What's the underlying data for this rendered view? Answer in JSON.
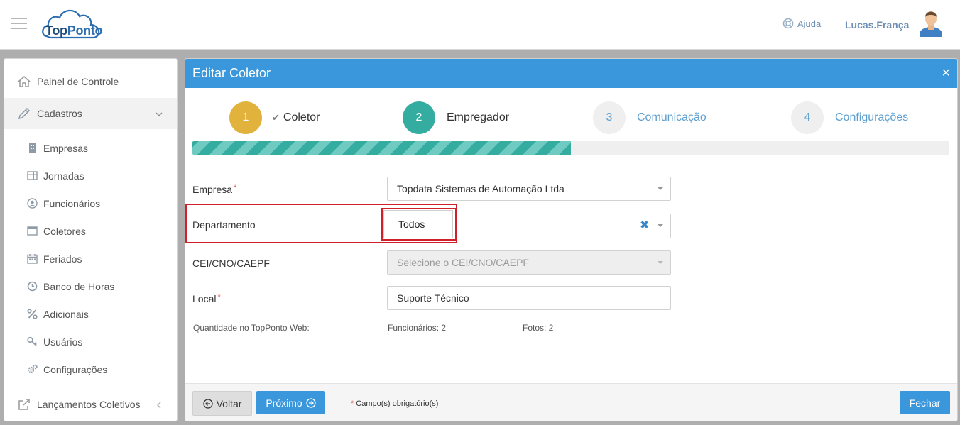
{
  "header": {
    "logo_text_1": "Top",
    "logo_text_2": "Ponto",
    "help_label": "Ajuda",
    "user_name": "Lucas.França"
  },
  "sidebar": {
    "panel": "Painel de Controle",
    "cadastros": "Cadastros",
    "items": [
      {
        "label": "Empresas",
        "icon": "building-icon"
      },
      {
        "label": "Jornadas",
        "icon": "table-icon"
      },
      {
        "label": "Funcionários",
        "icon": "user-circle-icon"
      },
      {
        "label": "Coletores",
        "icon": "window-icon"
      },
      {
        "label": "Feriados",
        "icon": "calendar-icon"
      },
      {
        "label": "Banco de Horas",
        "icon": "clock-icon"
      },
      {
        "label": "Adicionais",
        "icon": "percent-icon"
      },
      {
        "label": "Usuários",
        "icon": "key-icon"
      },
      {
        "label": "Configurações",
        "icon": "gears-icon"
      }
    ],
    "lancamentos": "Lançamentos Coletivos"
  },
  "modal": {
    "title": "Editar Coletor",
    "close": "×",
    "steps": [
      {
        "number": "1",
        "label": "Coletor",
        "state": "done",
        "color": "#e2b33c"
      },
      {
        "number": "2",
        "label": "Empregador",
        "state": "active",
        "color": "#35aca0"
      },
      {
        "number": "3",
        "label": "Comunicação",
        "state": "pending",
        "color": "#efefef"
      },
      {
        "number": "4",
        "label": "Configurações",
        "state": "pending",
        "color": "#efefef"
      }
    ],
    "progress_fraction": 0.5,
    "fields": {
      "empresa_label": "Empresa",
      "empresa_value": "Topdata Sistemas de Automação Ltda",
      "departamento_label": "Departamento",
      "departamento_value": "Todos",
      "cei_label": "CEI/CNO/CAEPF",
      "cei_placeholder": "Selecione o CEI/CNO/CAEPF",
      "local_label": "Local",
      "local_value": "Suporte Técnico"
    },
    "info": {
      "quantity_label": "Quantidade no TopPonto Web:",
      "employees": "Funcionários: 2",
      "photos": "Fotos: 2"
    },
    "footer": {
      "back": "Voltar",
      "next": "Próximo",
      "required_note": "Campo(s) obrigatório(s)",
      "close": "Fechar"
    }
  },
  "colors": {
    "primary": "#3a97dc",
    "step_done": "#e2b33c",
    "step_active": "#35aca0",
    "highlight": "#d0202a"
  }
}
